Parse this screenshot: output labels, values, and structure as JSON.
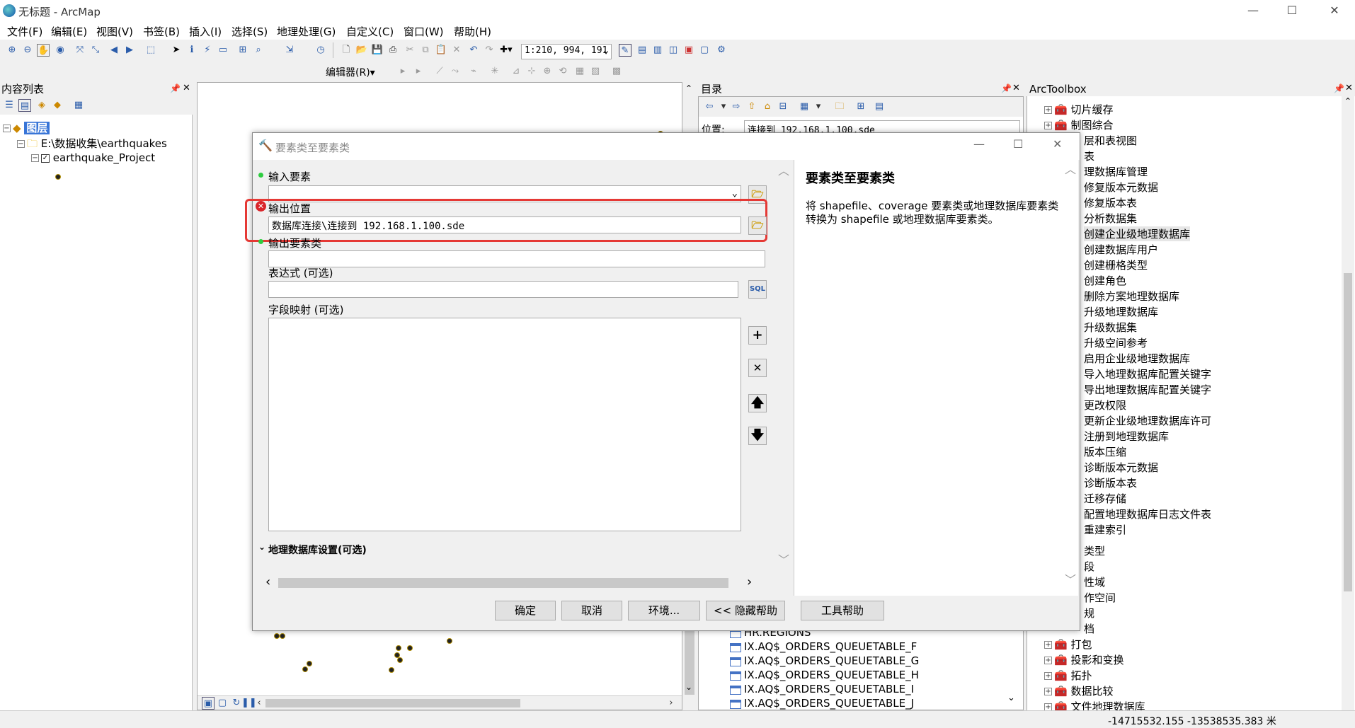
{
  "window": {
    "title": "无标题 - ArcMap",
    "min": "—",
    "max": "☐",
    "close": "✕"
  },
  "menu": [
    "文件(F)",
    "编辑(E)",
    "视图(V)",
    "书签(B)",
    "插入(I)",
    "选择(S)",
    "地理处理(G)",
    "自定义(C)",
    "窗口(W)",
    "帮助(H)"
  ],
  "toolbar": {
    "scale": "1:210, 994, 191",
    "editor": "编辑器(R)▾"
  },
  "toc": {
    "title": "内容列表",
    "root": "图层",
    "folder": "E:\\数据收集\\earthquakes",
    "layer": "earthquake_Project"
  },
  "catalog": {
    "title": "目录",
    "location_label": "位置:",
    "location_value": "连接到 192.168.1.100.sde",
    "items": [
      "HR.REGIONS",
      "IX.AQ$_ORDERS_QUEUETABLE_F",
      "IX.AQ$_ORDERS_QUEUETABLE_G",
      "IX.AQ$_ORDERS_QUEUETABLE_H",
      "IX.AQ$_ORDERS_QUEUETABLE_I",
      "IX.AQ$_ORDERS_QUEUETABLE_J"
    ]
  },
  "toolbox": {
    "title": "ArcToolbox",
    "top_items": [
      "切片缓存",
      "制图综合"
    ],
    "partial_items": [
      "层和表视图",
      "表",
      "理数据库管理"
    ],
    "sub_items": [
      "修复版本元数据",
      "修复版本表",
      "分析数据集",
      "创建企业级地理数据库",
      "创建数据库用户",
      "创建栅格类型",
      "创建角色",
      "删除方案地理数据库",
      "升级地理数据库",
      "升级数据集",
      "升级空间参考",
      "启用企业级地理数据库",
      "导入地理数据库配置关键字",
      "导出地理数据库配置关键字",
      "更改权限",
      "更新企业级地理数据库许可",
      "注册到地理数据库",
      "版本压缩",
      "诊断版本元数据",
      "诊断版本表",
      "迁移存储",
      "配置地理数据库日志文件表",
      "重建索引"
    ],
    "partial_after": [
      "类型",
      "段",
      "性域",
      "作空间",
      "规",
      "档"
    ],
    "bottom_items": [
      "打包",
      "投影和变换",
      "拓扑",
      "数据比较",
      "文件地理数据库"
    ]
  },
  "dialog": {
    "title": "要素类至要素类",
    "input_label": "输入要素",
    "input_value": "",
    "output_location_label": "输出位置",
    "output_location_value": "数据库连接\\连接到 192.168.1.100.sde",
    "output_fc_label": "输出要素类",
    "output_fc_value": "",
    "expression_label": "表达式 (可选)",
    "expression_value": "",
    "field_map_label": "字段映射 (可选)",
    "geodb_settings": "地理数据库设置(可选)",
    "buttons": {
      "ok": "确定",
      "cancel": "取消",
      "env": "环境...",
      "hide_help": "<< 隐藏帮助",
      "tool_help": "工具帮助"
    },
    "help_title": "要素类至要素类",
    "help_body": "将 shapefile、coverage 要素类或地理数据库要素类转换为 shapefile 或地理数据库要素类。"
  },
  "status": {
    "coords": "-14715532.155  -13538535.383 米"
  },
  "colors": {
    "highlight": "#e53935",
    "selection": "#3875d7",
    "required_dot": "#2ecc40",
    "error": "#d9252a"
  }
}
